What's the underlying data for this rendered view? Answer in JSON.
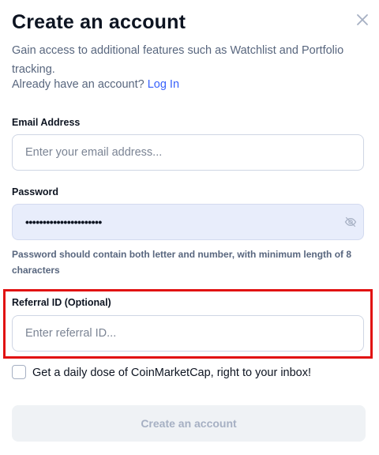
{
  "header": {
    "title": "Create an account",
    "close_icon": "close-icon"
  },
  "intro": {
    "subtitle": "Gain access to additional features such as Watchlist and Portfolio tracking.",
    "login_prompt": "Already have an account?",
    "login_link": "Log In"
  },
  "form": {
    "email": {
      "label": "Email Address",
      "placeholder": "Enter your email address...",
      "value": ""
    },
    "password": {
      "label": "Password",
      "value": "••••••••••••••••••••••",
      "toggle_icon": "eye-off-icon",
      "hint": "Password should contain both letter and number, with minimum length of 8 characters"
    },
    "referral": {
      "label": "Referral ID (Optional)",
      "placeholder": "Enter referral ID...",
      "value": ""
    },
    "newsletter": {
      "label": "Get a daily dose of CoinMarketCap, right to your inbox!",
      "checked": false
    },
    "submit_label": "Create an account"
  },
  "colors": {
    "accent_link": "#3861fb",
    "highlight": "#e11212",
    "password_field_bg": "#e8edfb",
    "button_disabled_bg": "#eff2f5"
  }
}
